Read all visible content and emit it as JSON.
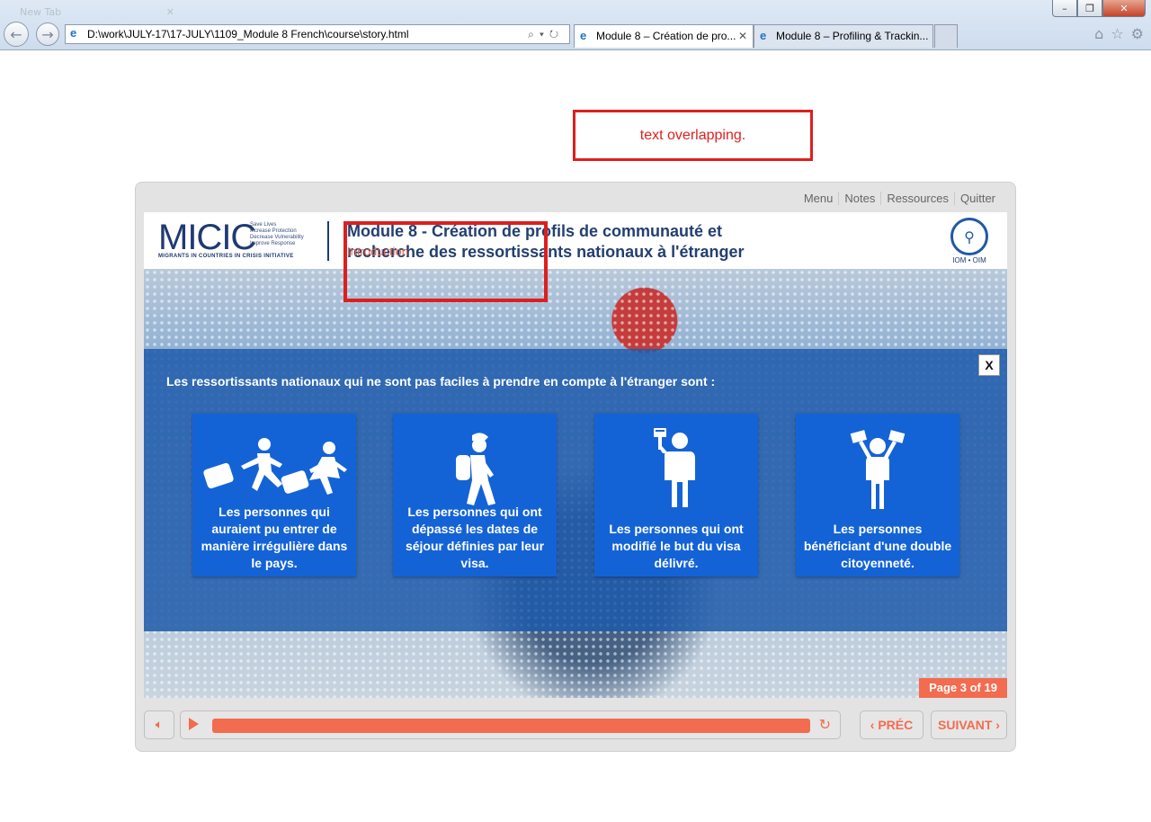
{
  "browser": {
    "ghost_tab": "New Tab",
    "address": "D:\\work\\JULY-17\\17-JULY\\1109_Module 8 French\\course\\story.html",
    "tabs": [
      {
        "label": "Module 8 – Création de pro...",
        "active": true
      },
      {
        "label": "Module 8 – Profiling & Trackin...",
        "active": false
      }
    ],
    "tab_close": "✕"
  },
  "annotation": {
    "note": "text overlapping."
  },
  "player": {
    "menu": [
      "Menu",
      "Notes",
      "Ressources",
      "Quitter"
    ],
    "progress_percent": 100,
    "prev_label": "PRÉC",
    "next_label": "SUIVANT",
    "page_label": "Page 3 of 19"
  },
  "slide": {
    "logo": {
      "word": "MICIC",
      "taglines": [
        "Save Lives",
        "Increase Protection",
        "Decrease Vulnerability",
        "Improve Response"
      ],
      "subtitle": "MIGRANTS IN COUNTRIES IN CRISIS INITIATIVE"
    },
    "title_line1": "Module 8 - Création de profils de communauté et",
    "title_line2": "recherche des ressortissants nationaux à l'étranger",
    "section_label": "Introduction",
    "iom_label": "IOM • OIM",
    "close_label": "X",
    "lead": "Les ressortissants nationaux qui ne sont pas faciles à prendre en compte à l'étranger sont :",
    "cards": [
      {
        "icon": "running-with-luggage-icon",
        "label": "Les personnes qui auraient pu entrer de manière irrégulière dans le pays."
      },
      {
        "icon": "backpacker-icon",
        "label": "Les personnes qui ont dépassé les dates de séjour définies par leur visa."
      },
      {
        "icon": "person-with-document-icon",
        "label": "Les personnes qui ont modifié le but du visa délivré."
      },
      {
        "icon": "person-with-two-flags-icon",
        "label": "Les personnes bénéficiant d'une double citoyenneté."
      }
    ]
  },
  "colors": {
    "accent": "#f26c4f",
    "overlay": "#1e5aaa",
    "card": "#1463d6",
    "annotation": "#dd1f1f"
  }
}
